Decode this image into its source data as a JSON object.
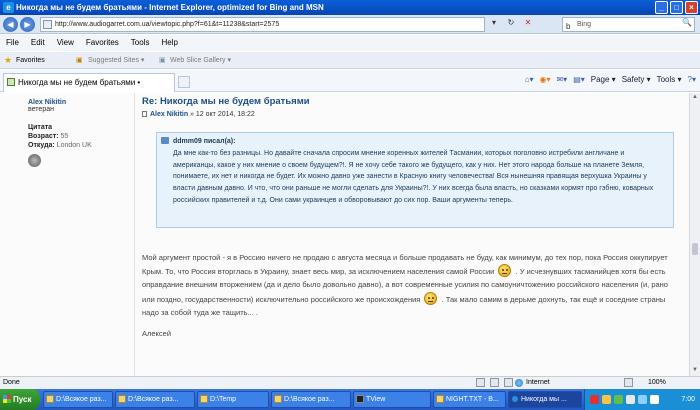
{
  "window": {
    "title": "Никогда мы не будем братьями - Internet Explorer, optimized for Bing and MSN",
    "minimize": "_",
    "maximize": "□",
    "close": "×"
  },
  "address_bar": {
    "back": "◀",
    "forward": "▶",
    "url": "http://www.audiogarret.com.ua/viewtopic.php?f=61&t=11238&start=2575",
    "refresh": "↻",
    "stop": "✕",
    "dropdown": "▾",
    "search_placeholder": "Bing",
    "search_go": "🔍"
  },
  "menu": [
    "File",
    "Edit",
    "View",
    "Favorites",
    "Tools",
    "Help"
  ],
  "favorites_bar": {
    "label": "Favorites",
    "items": [
      "Suggested Sites ▾",
      "Web Slice Gallery ▾"
    ]
  },
  "tab": {
    "label": "Никогда мы не будем братьями •"
  },
  "command_bar": [
    "Page ▾",
    "Safety ▾",
    "Tools ▾"
  ],
  "post": {
    "author": "Alex Nikitin",
    "rank": "ветеран",
    "quote_link": "Цитата",
    "age_label": "Возраст:",
    "age": "55",
    "location_label": "Откуда:",
    "location": "London UK",
    "title": "Re: Никогда мы не будем братьями",
    "meta_author": "Alex Nikitin",
    "meta_date": "» 12 окт 2014, 18:22",
    "quote_author": "ddmm09 писал(а):",
    "quote_text": "Да мне как-то без разницы. Но давайте сначала спросим мнение коренных жителей Тасмании, которых поголовно истребили англичане и американцы, какое у них мнение о своем будущем?!. Я не хочу себе такого же будущего, как у них. Нет этого народа больше на планете Земля, понимаете, их нет и никогда не будет. Их можно давно уже занести в Красную книгу человечества! Вся нынешняя правящая верхушка Украины у власти давным давно. И что, что они раньше не могли сделать для Украины?!. У них всегда была власть, но сказками кормят про гэбню, коварных российских правителей и т.д. Они сами украинцев и обворовывают до сих пор. Ваши аргументы теперь.",
    "reply_part1": "Мой аргумент простой - я в Россию ничего не продаю с августа месяца и больше продавать не буду, как минимум, до тех пор, пока Россия оккупирует Крым. То, что Россия вторглась в Украину, знает весь мир, за исключением населения самой России",
    "reply_part2": ". У исчезнувших тасманийцев хотя бы есть оправдание внешним вторжением (да и дело было довольно давно), а вот современные усилия по самоуничтожению российского населения (и, рано или поздно, государственности) исключительно российского же происхождения",
    "reply_part3": ". Так мало самим в дерьме дохнуть, так ещё и соседние страны надо за собой туда же тащить... .",
    "signature": "Алексей"
  },
  "status_bar": {
    "status": "Done",
    "zone": "Internet",
    "zoom": "100%"
  },
  "taskbar": {
    "start": "Пуск",
    "tasks": [
      "D:\\Всякое раз...",
      "D:\\Всякое раз...",
      "D:\\Temp",
      "D:\\Всякое раз...",
      "TView",
      "NIGHT.TXT - В...",
      "Никогда мы ..."
    ],
    "clock": "7:00"
  },
  "colors": {
    "link_blue": "#1b4f82",
    "quote_bg": "#e8f2fb",
    "title_bar": "#0a5fd8"
  }
}
